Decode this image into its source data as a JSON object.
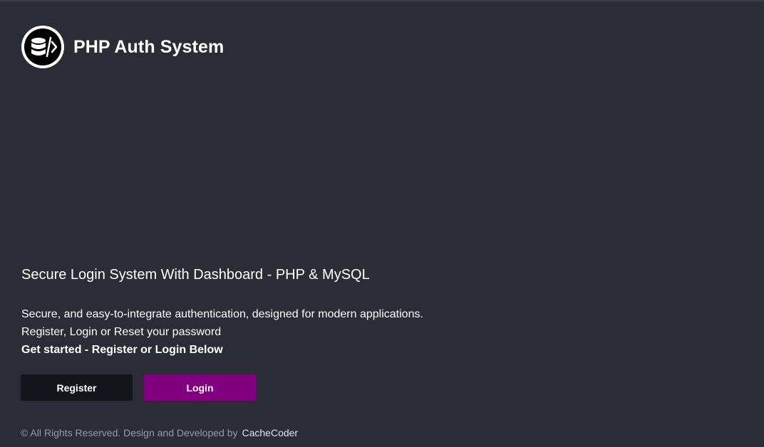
{
  "brand": {
    "title": "PHP Auth System",
    "logo_icon": "database-code-icon"
  },
  "hero": {
    "headline": "Secure Login System With Dashboard - PHP & MySQL",
    "line1": "Secure, and easy-to-integrate authentication, designed for modern applications.",
    "line2": "Register, Login or Reset your password",
    "line3": "Get started - Register or Login Below"
  },
  "actions": {
    "register_label": "Register",
    "login_label": "Login"
  },
  "footer": {
    "text": "© All Rights Reserved. Design and Developed by",
    "author_link": "CacheCoder"
  },
  "colors": {
    "background": "#2c2c37",
    "register_button": "#15151c",
    "login_button": "#800080"
  }
}
